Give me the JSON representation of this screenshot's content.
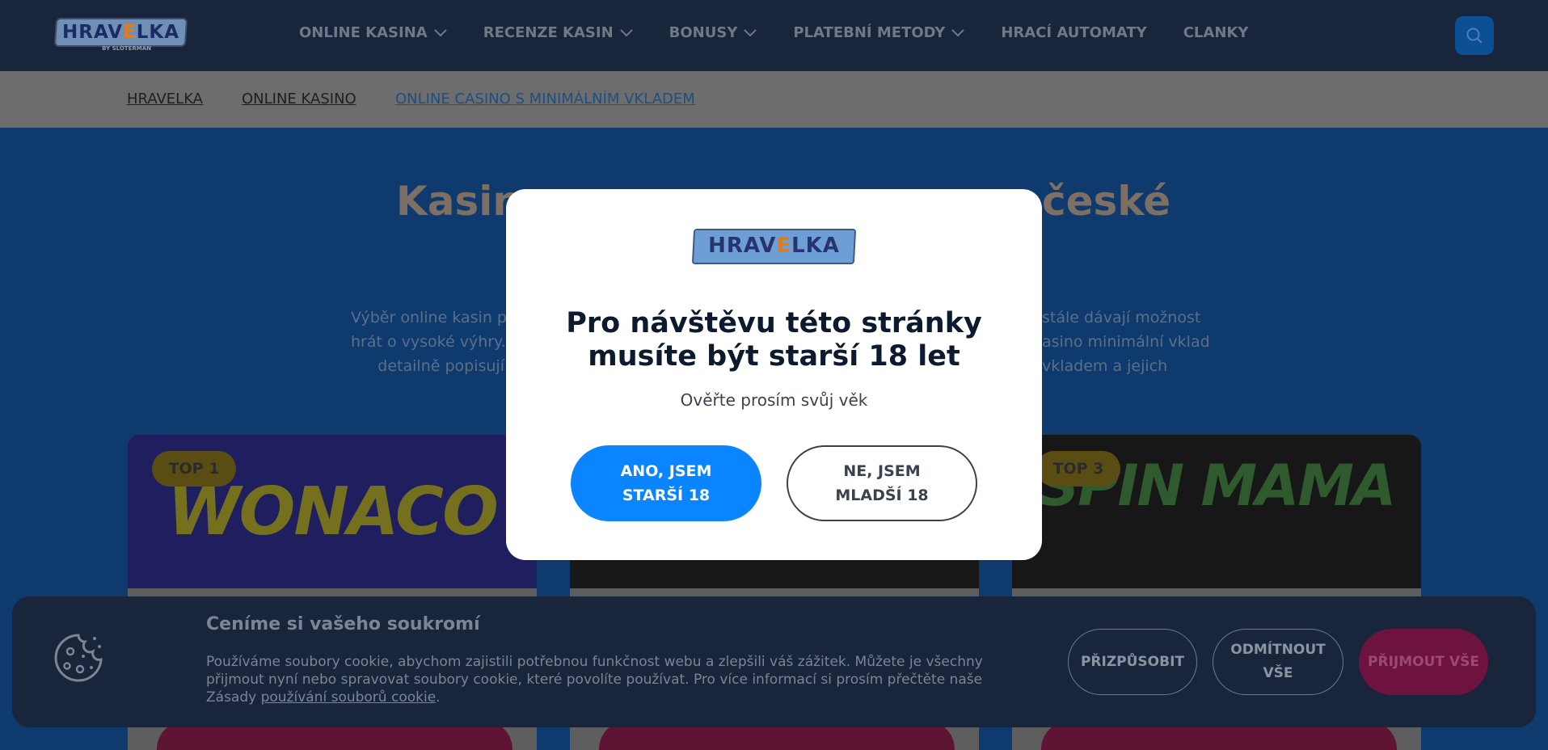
{
  "header": {
    "logo_text_a": "HRAV",
    "logo_text_b": "E",
    "logo_text_c": "LKA",
    "logo_byline": "BY SLOTERMAN",
    "nav": [
      {
        "label": "ONLINE KASINA",
        "has_dropdown": true
      },
      {
        "label": "RECENZE KASIN",
        "has_dropdown": true
      },
      {
        "label": "BONUSY",
        "has_dropdown": true
      },
      {
        "label": "PLATEBNÍ METODY",
        "has_dropdown": true
      },
      {
        "label": "HRACÍ AUTOMATY",
        "has_dropdown": false
      },
      {
        "label": "CLANKY",
        "has_dropdown": false
      }
    ],
    "search_icon": "search-icon"
  },
  "breadcrumb": [
    "HRAVELKA",
    "ONLINE KASINO",
    "ONLINE CASINO S MINIMÁLNÍM VKLADEM"
  ],
  "page": {
    "headline_left": "Kasina",
    "headline_right": "české",
    "para_left": [
      "Výběr online kasin p",
      "hrát o vysoké výhry.",
      "detailně popisují"
    ],
    "para_right": [
      "stále dávají možnost",
      "asino minimální vklad",
      "vkladem a jejich"
    ],
    "cards": [
      {
        "badge": "TOP 1",
        "brand": "WONACO"
      },
      {
        "badge": "",
        "brand": ""
      },
      {
        "badge": "TOP 3",
        "brand": "SPIN MAMA"
      }
    ]
  },
  "modal": {
    "logo_a": "HRAV",
    "logo_b": "E",
    "logo_c": "LKA",
    "title_line1": "Pro návštěvu této stránky",
    "title_line2": "musíte být starší 18 let",
    "subtitle": "Ověřte prosím svůj věk",
    "yes_line1": "ANO, JSEM",
    "yes_line2": "STARŠÍ 18",
    "no_line1": "NE, JSEM",
    "no_line2": "MLADŠÍ 18"
  },
  "cookie": {
    "icon": "cookie-icon",
    "title": "Ceníme si vašeho soukromí",
    "text": "Používáme soubory cookie, abychom zajistili potřebnou funkčnost webu a zlepšili váš zážitek. Můžete je všechny přijmout nyní nebo spravovat soubory cookie, které povolíte používat. Pro více informací si prosím přečtěte naše Zásady ",
    "link": "používání souborů cookie",
    "period": ".",
    "customize_line1": "PŘIZPŮSOBIT",
    "reject_line1": "ODMÍTNOUT",
    "reject_line2": "VŠE",
    "accept_line1": "PŘIJMOUT VŠE"
  },
  "colors": {
    "header_bg": "#18253a",
    "page_bg": "#0e3a6e",
    "primary_button": "#0a84ff",
    "accept_button": "#6e1240"
  }
}
